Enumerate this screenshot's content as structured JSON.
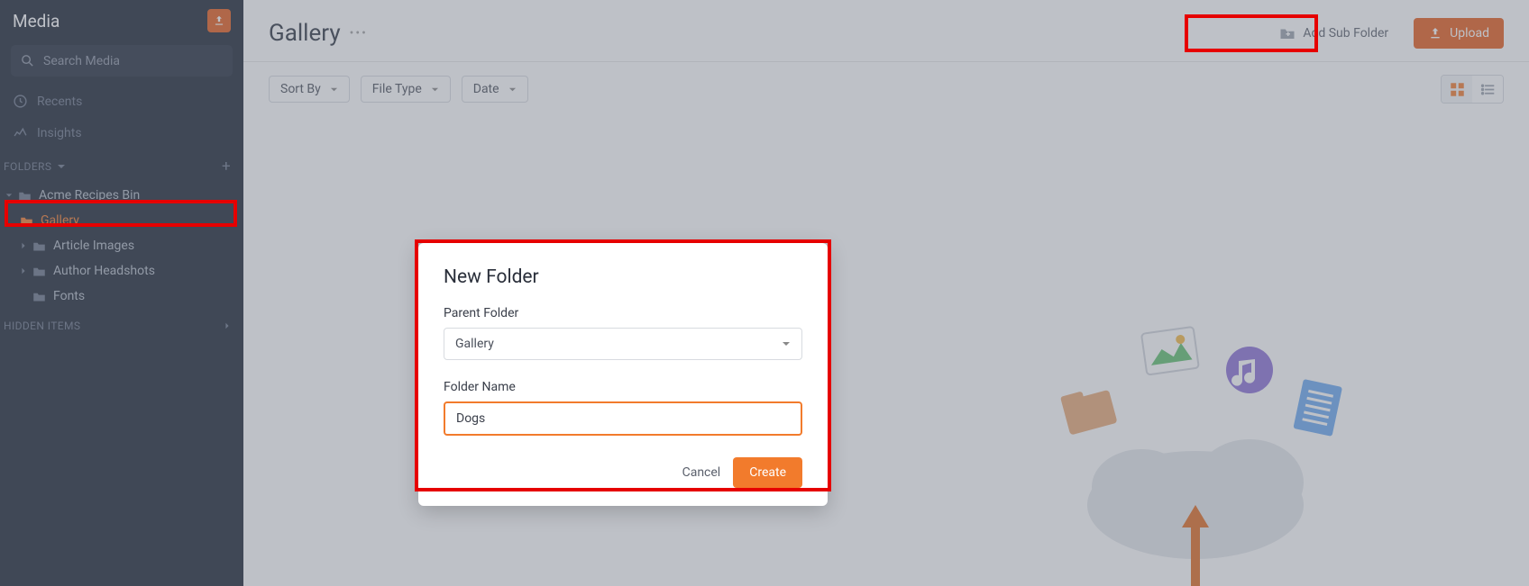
{
  "sidebar": {
    "title": "Media",
    "search_placeholder": "Search Media",
    "recents": "Recents",
    "insights": "Insights",
    "folders_label": "FOLDERS",
    "hidden_label": "HIDDEN ITEMS",
    "tree": {
      "root": "Acme Recipes Bin",
      "gallery": "Gallery",
      "article_images": "Article Images",
      "author_headshots": "Author Headshots",
      "fonts": "Fonts"
    }
  },
  "header": {
    "title": "Gallery",
    "add_sub": "Add Sub Folder",
    "upload": "Upload"
  },
  "filters": {
    "sort_by": "Sort By",
    "file_type": "File Type",
    "date": "Date"
  },
  "modal": {
    "title": "New Folder",
    "parent_label": "Parent Folder",
    "parent_value": "Gallery",
    "name_label": "Folder Name",
    "name_value": "Dogs",
    "cancel": "Cancel",
    "create": "Create"
  }
}
